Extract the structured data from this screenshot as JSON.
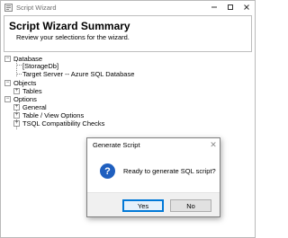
{
  "window": {
    "title": "Script Wizard"
  },
  "header": {
    "title": "Script Wizard Summary",
    "subtitle": "Review your selections for the wizard."
  },
  "tree": {
    "database": {
      "label": "Database",
      "toggle": "−",
      "db_name": "[StorageDb]",
      "target_server": "Target Server -- Azure SQL Database"
    },
    "objects": {
      "label": "Objects",
      "toggle": "−",
      "tables": {
        "label": "Tables",
        "toggle": "+"
      }
    },
    "options": {
      "label": "Options",
      "toggle": "−",
      "children": [
        {
          "label": "General",
          "toggle": "+"
        },
        {
          "label": "Table / View Options",
          "toggle": "+"
        },
        {
          "label": "TSQL Compatibility Checks",
          "toggle": "+"
        }
      ]
    }
  },
  "dialog": {
    "title": "Generate Script",
    "close_glyph": "✕",
    "icon_glyph": "?",
    "message": "Ready to generate SQL script?",
    "yes_label": "Yes",
    "no_label": "No"
  },
  "colors": {
    "accent": "#0078d7",
    "question_icon": "#1f5fbf"
  }
}
